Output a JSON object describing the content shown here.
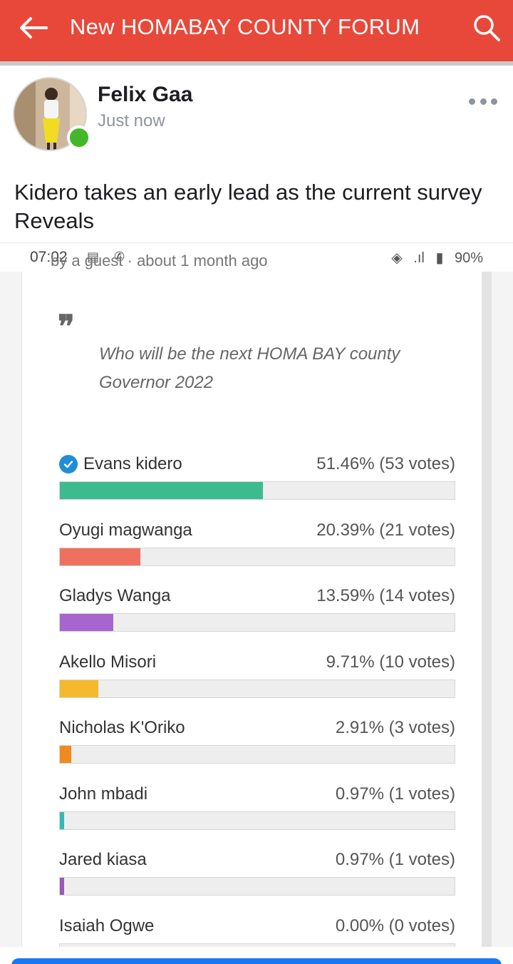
{
  "app_bar": {
    "title": "New HOMABAY COUNTY FORUM",
    "back_icon": "arrow-left-icon",
    "search_icon": "search-icon",
    "color": "#e8483a"
  },
  "post": {
    "author": "Felix Gaa",
    "time": "Just now",
    "text": "Kidero takes an early lead as the current survey Reveals",
    "more_icon": "more-horizontal-icon",
    "online_color": "#42b72a"
  },
  "screenshot": {
    "status_time": "07:02",
    "battery": "90%",
    "cut_text": "by a guest · about 1 month ago",
    "question": "Who will be the next HOMA BAY county Governor 2022",
    "options": [
      {
        "name": "Evans kidero",
        "result": "51.46% (53 votes)",
        "percent": 51.46,
        "color": "#3dbb8e",
        "checked": true
      },
      {
        "name": "Oyugi magwanga",
        "result": "20.39% (21 votes)",
        "percent": 20.39,
        "color": "#f07060",
        "checked": false
      },
      {
        "name": "Gladys Wanga",
        "result": "13.59% (14 votes)",
        "percent": 13.59,
        "color": "#a865d0",
        "checked": false
      },
      {
        "name": "Akello Misori",
        "result": "9.71% (10 votes)",
        "percent": 9.71,
        "color": "#f5b92e",
        "checked": false
      },
      {
        "name": "Nicholas K'Oriko",
        "result": "2.91% (3 votes)",
        "percent": 2.91,
        "color": "#f08a1c",
        "checked": false
      },
      {
        "name": "John mbadi",
        "result": "0.97% (1 votes)",
        "percent": 0.97,
        "color": "#36b8b8",
        "checked": false
      },
      {
        "name": "Jared kiasa",
        "result": "0.97% (1 votes)",
        "percent": 0.97,
        "color": "#9b59b6",
        "checked": false
      },
      {
        "name": "Isaiah Ogwe",
        "result": "0.00% (0 votes)",
        "percent": 0,
        "color": "#cccccc",
        "checked": false
      }
    ]
  }
}
